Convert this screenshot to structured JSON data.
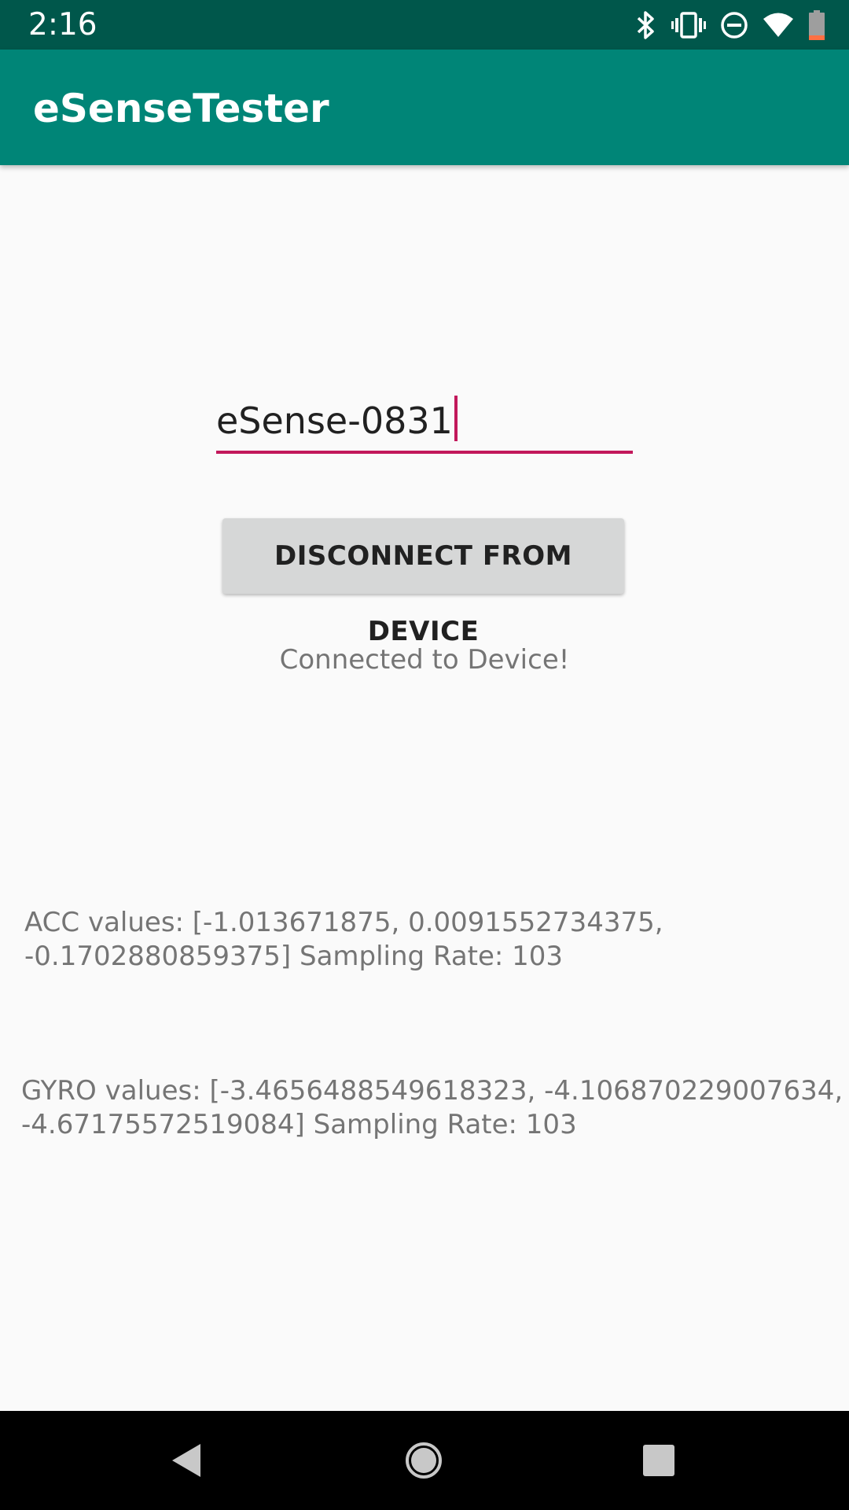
{
  "status_bar": {
    "time": "2:16",
    "icons": [
      "bluetooth-icon",
      "vibrate-icon",
      "do-not-disturb-icon",
      "wifi-icon",
      "battery-icon"
    ]
  },
  "app_bar": {
    "title": "eSenseTester"
  },
  "main": {
    "device_name_value": "eSense-0831",
    "disconnect_button_label": "DISCONNECT FROM DEVICE",
    "connection_status": "Connected to Device!",
    "acc_line1": "ACC values: [-1.013671875, 0.0091552734375,",
    "acc_line2": "-0.1702880859375] Sampling Rate: 103",
    "gyro_line1": "GYRO values: [-3.4656488549618323, -4.106870229007634,",
    "gyro_line2": "-4.67175572519084] Sampling Rate: 103"
  },
  "nav_bar": {
    "buttons": [
      "back-icon",
      "home-icon",
      "recents-icon"
    ]
  },
  "colors": {
    "status_bar": "#00574b",
    "app_bar": "#008577",
    "accent": "#c2185b",
    "button": "#d6d7d7",
    "secondary_text": "#757575"
  }
}
